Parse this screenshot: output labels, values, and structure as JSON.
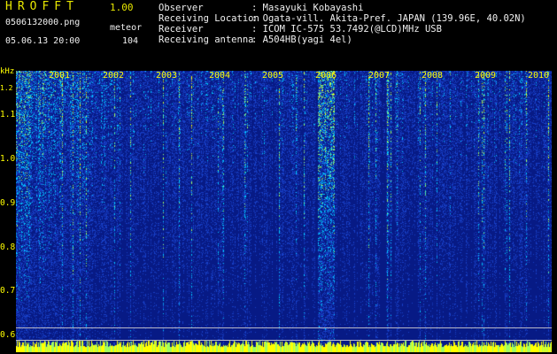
{
  "app": {
    "title": "HROFFT",
    "version": "1.00"
  },
  "file": {
    "name": "0506132000.png",
    "datetime": "05.06.13 20:00"
  },
  "detection": {
    "mode_label": "meteor",
    "count": "104"
  },
  "station": {
    "rows": [
      {
        "label": "Observer",
        "value": ": Masayuki Kobayashi"
      },
      {
        "label": "Receiving Location",
        "value": ": Ogata-vill. Akita-Pref. JAPAN (139.96E, 40.02N)"
      },
      {
        "label": "Receiver",
        "value": ": ICOM IC-575 53.7492(@LCD)MHz USB"
      },
      {
        "label": "Receiving antenna",
        "value": ": A504HB(yagi 4el)"
      }
    ]
  },
  "spectrogram": {
    "time_markers": [
      "2001",
      "2002",
      "2003",
      "2004",
      "2005",
      "2006",
      "2007",
      "2008",
      "2009",
      "2010"
    ],
    "freq_unit": "kHz",
    "freq_ticks": [
      "1.2",
      "1.1",
      "1.0",
      "0.9",
      "0.8",
      "0.7",
      "0.6"
    ],
    "freq_values": [
      1.2,
      1.1,
      1.0,
      0.9,
      0.8,
      0.7,
      0.6
    ],
    "colors": {
      "background": "#071a85",
      "low": "#1840c8",
      "mid": "#00c8ff",
      "high": "#a0ff60",
      "peak": "#ffff00",
      "label": "#ffff00"
    }
  }
}
